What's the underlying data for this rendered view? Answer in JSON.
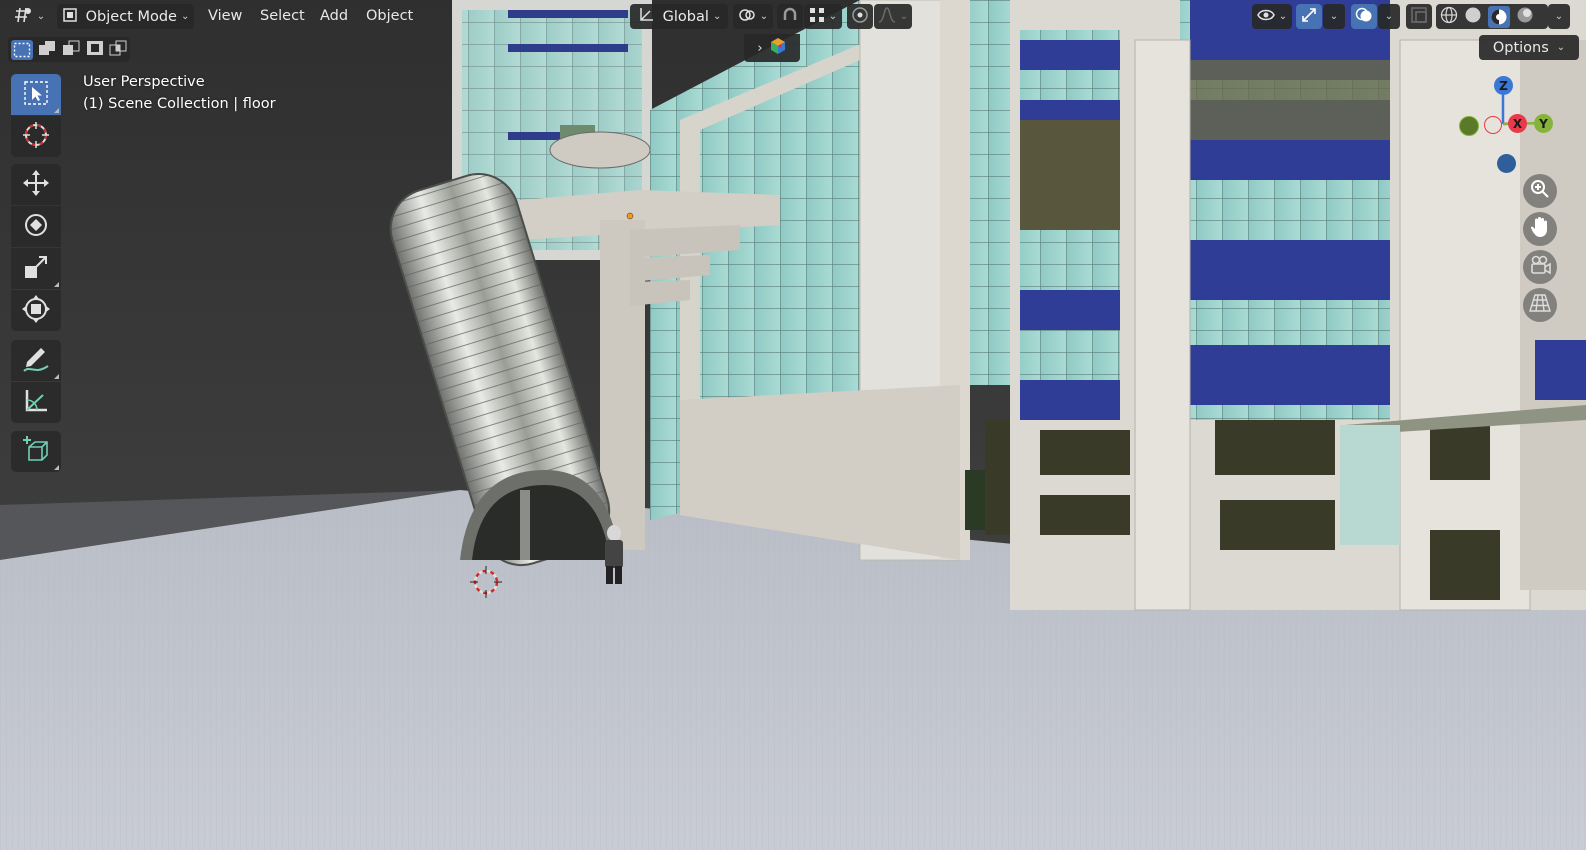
{
  "header": {
    "editor_type_icon": "viewport-editor-icon",
    "mode": {
      "label": "Object Mode",
      "icon": "object-mode-icon"
    },
    "menus": [
      "View",
      "Select",
      "Add",
      "Object"
    ],
    "transform_orientation": {
      "label": "Global",
      "icon": "orientation-icon"
    },
    "pivot_icon": "pivot-point-icon",
    "snap_icon": "magnet-snap-icon",
    "snap_target_icon": "snap-increment-icon",
    "proportional_icon": "proportional-editing-icon",
    "falloff_icon": "falloff-curve-icon",
    "visibility_icon": "eye-icon",
    "gizmo_icon": "gizmo-icon",
    "overlay_icon": "overlay-icon",
    "xray_icon": "xray-icon",
    "shading_modes": [
      "wireframe",
      "solid",
      "material-preview",
      "rendered"
    ],
    "active_shading": "material-preview"
  },
  "selection_modes": [
    "select-new",
    "select-extend",
    "select-subtract",
    "select-invert",
    "select-intersect"
  ],
  "sidebar_toggle_icon": "chevron-right-icon",
  "options_label": "Options",
  "viewport": {
    "view_name": "User Perspective",
    "collection_text": "(1) Scene Collection | floor"
  },
  "tools": [
    {
      "name": "select-box-tool",
      "icon": "select-box-icon",
      "active": true
    },
    {
      "name": "cursor-tool",
      "icon": "cursor-icon",
      "active": false
    },
    {
      "name": "move-tool",
      "icon": "move-icon",
      "active": false
    },
    {
      "name": "rotate-tool",
      "icon": "rotate-icon",
      "active": false
    },
    {
      "name": "scale-tool",
      "icon": "scale-icon",
      "active": false
    },
    {
      "name": "transform-tool",
      "icon": "transform-icon",
      "active": false
    },
    {
      "name": "annotate-tool",
      "icon": "annotate-icon",
      "active": false
    },
    {
      "name": "measure-tool",
      "icon": "measure-icon",
      "active": false
    },
    {
      "name": "add-cube-tool",
      "icon": "add-cube-icon",
      "active": false
    }
  ],
  "nav_gizmo": {
    "axes": [
      "X",
      "Y",
      "Z"
    ],
    "colors": {
      "x": "#e83a4a",
      "y": "#86b43a",
      "z": "#3a78d8"
    }
  },
  "nav_buttons": [
    "zoom-icon",
    "hand-pan-icon",
    "camera-icon",
    "grid-view-icon"
  ],
  "colors": {
    "accent": "#4772b3",
    "header_bg": "#282828",
    "floor": "#c4c8d0",
    "sky": "#3a3a3a"
  }
}
